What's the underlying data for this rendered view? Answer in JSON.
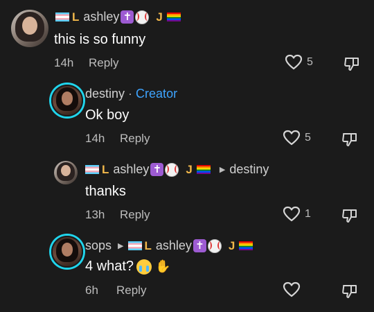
{
  "labels": {
    "reply": "Reply"
  },
  "comments": [
    {
      "username": "ashley",
      "text": "this is so funny",
      "time": "14h",
      "likes": "5",
      "creator_badge": ""
    },
    {
      "username": "destiny",
      "separator": "·",
      "creator_badge": "Creator",
      "text": "Ok boy",
      "time": "14h",
      "likes": "5"
    },
    {
      "username": "ashley",
      "reply_to": "destiny",
      "text": "thanks",
      "time": "13h",
      "likes": "1"
    },
    {
      "username": "sops",
      "reply_to_name": "ashley",
      "text": "4 what?",
      "time": "6h",
      "likes": ""
    }
  ],
  "colors": {
    "background": "#1b1b1b",
    "creator_accent": "#3ea4ff",
    "story_ring": "#20d5ec"
  },
  "icons": [
    "heart-outline-icon",
    "dislike-icon",
    "reply-arrow-icon"
  ]
}
